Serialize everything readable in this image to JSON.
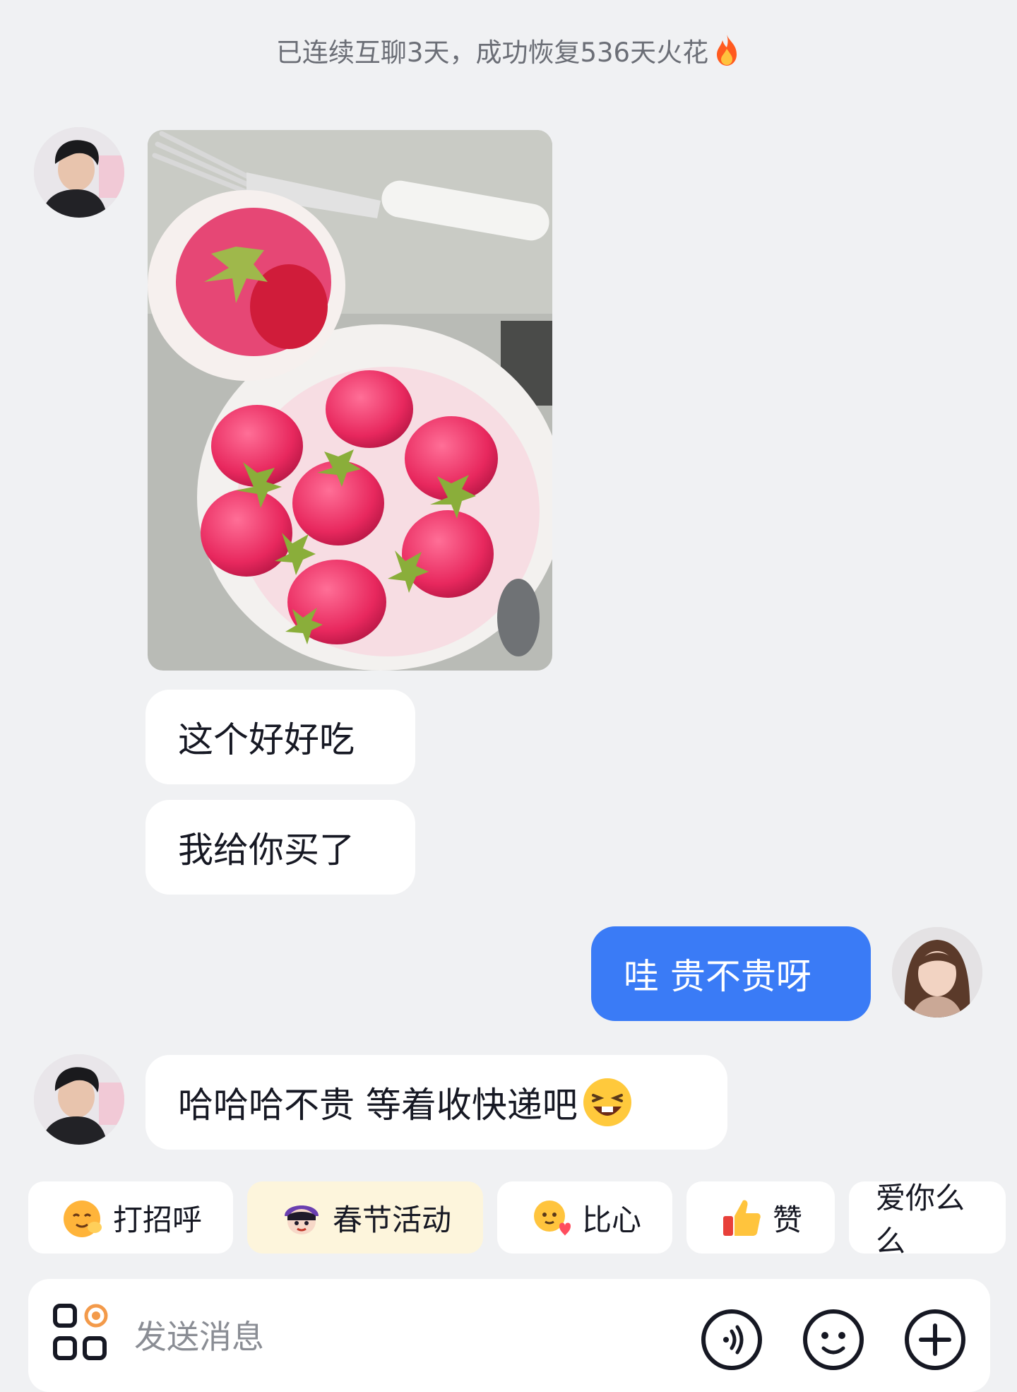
{
  "header": {
    "streak_text": "已连续互聊3天，成功恢复536天火花",
    "streak_icon": "flame-icon"
  },
  "messages": [
    {
      "sender": "friend",
      "type": "image",
      "description_icon": "photo-strawberry-mochi"
    },
    {
      "sender": "friend",
      "type": "text",
      "text": "这个好好吃"
    },
    {
      "sender": "friend",
      "type": "text",
      "text": "我给你买了"
    },
    {
      "sender": "me",
      "type": "text",
      "text": "哇 贵不贵呀"
    },
    {
      "sender": "friend",
      "type": "text",
      "text": "哈哈哈不贵 等着收快递吧",
      "emoji": "laughing-emoji-icon"
    }
  ],
  "quick_replies": [
    {
      "label": "打招呼",
      "icon": "wave-emoji-icon"
    },
    {
      "label": "春节活动",
      "icon": "festival-character-icon"
    },
    {
      "label": "比心",
      "icon": "heart-hands-emoji-icon"
    },
    {
      "label": "赞",
      "icon": "thumbs-up-icon"
    },
    {
      "label": "爱你么么",
      "icon": ""
    }
  ],
  "composer": {
    "placeholder": "发送消息",
    "icons": [
      "apps-icon",
      "voice-icon",
      "emoji-icon",
      "plus-icon"
    ]
  },
  "colors": {
    "background": "#f0f1f3",
    "incoming_bubble": "#ffffff",
    "outgoing_bubble": "#3a7bf6",
    "festival_chip": "#fdf5dc"
  }
}
